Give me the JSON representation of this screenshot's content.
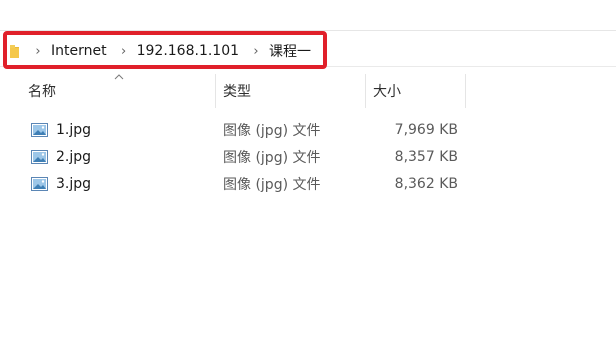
{
  "address_bar": {
    "breadcrumb": [
      "Internet",
      "192.168.1.101",
      "课程一"
    ],
    "separator": "›",
    "highlight_color": "#e0202a"
  },
  "columns": {
    "name": "名称",
    "type": "类型",
    "size": "大小"
  },
  "files": [
    {
      "name": "1.jpg",
      "type": "图像 (jpg) 文件",
      "size": "7,969 KB",
      "icon": "image-file-icon"
    },
    {
      "name": "2.jpg",
      "type": "图像 (jpg) 文件",
      "size": "8,357 KB",
      "icon": "image-file-icon"
    },
    {
      "name": "3.jpg",
      "type": "图像 (jpg) 文件",
      "size": "8,362 KB",
      "icon": "image-file-icon"
    }
  ],
  "icons": {
    "folder": "folder-icon",
    "sort": "sort-up-icon"
  }
}
